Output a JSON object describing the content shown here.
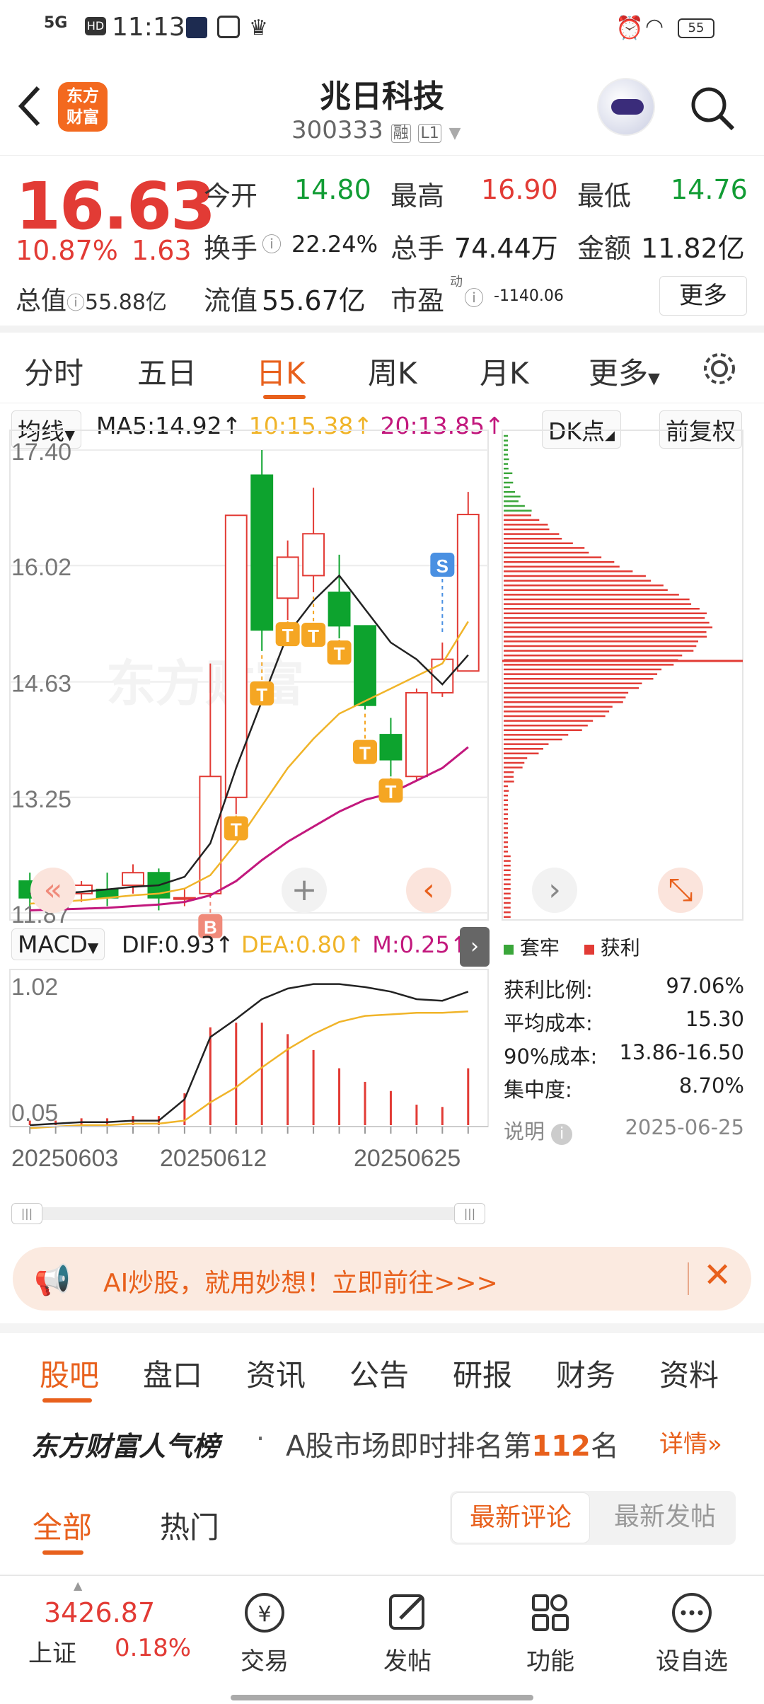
{
  "status": {
    "network": "5G",
    "hd": "HD",
    "time": "11:13",
    "battery": "55"
  },
  "nav": {
    "title": "兆日科技",
    "code": "300333",
    "tag_rong": "融",
    "tag_level": "L1",
    "logo_line1": "东方",
    "logo_line2": "财富"
  },
  "quote": {
    "price": "16.63",
    "change_pct": "10.87%",
    "change_amt": "1.63",
    "open_label": "今开",
    "open": "14.80",
    "high_label": "最高",
    "high": "16.90",
    "low_label": "最低",
    "low": "14.76",
    "turnover_label": "换手",
    "turnover": "22.24%",
    "volume_label": "总手",
    "volume": "74.44万",
    "amount_label": "金额",
    "amount": "11.82亿",
    "mcap_label": "总值",
    "mcap": "55.88亿",
    "float_label": "流值",
    "float": "55.67亿",
    "pe_label": "市盈",
    "pe_sup": "动",
    "pe": "-1140.06",
    "more": "更多"
  },
  "tabs": [
    "分时",
    "五日",
    "日K",
    "周K",
    "月K",
    "更多"
  ],
  "active_tab": 2,
  "kline": {
    "ma_select": "均线",
    "ma5": "MA5:14.92↑",
    "ma10": "10:15.38↑",
    "ma20": "20:13.85↑",
    "dk": "DK点",
    "fq": "前复权",
    "y_labels": [
      "17.40",
      "16.02",
      "14.63",
      "13.25",
      "11.87"
    ],
    "watermark": "东方财富",
    "colors": {
      "up": "#e23b35",
      "down": "#0da32e",
      "ma5": "#222222",
      "ma10": "#f0b429",
      "ma20": "#c2187d"
    }
  },
  "chart_data": {
    "type": "candlestick",
    "ylim": [
      11.87,
      17.4
    ],
    "candles": [
      {
        "o": 12.25,
        "c": 12.05,
        "h": 12.35,
        "l": 11.95
      },
      {
        "o": 12.05,
        "c": 12.15,
        "h": 12.25,
        "l": 11.95
      },
      {
        "o": 12.1,
        "c": 12.2,
        "h": 12.25,
        "l": 12.0
      },
      {
        "o": 12.15,
        "c": 12.05,
        "h": 12.35,
        "l": 11.95
      },
      {
        "o": 12.2,
        "c": 12.35,
        "h": 12.45,
        "l": 12.1
      },
      {
        "o": 12.35,
        "c": 12.05,
        "h": 12.4,
        "l": 11.9
      },
      {
        "o": 12.05,
        "c": 12.05,
        "h": 12.15,
        "l": 11.95
      },
      {
        "o": 12.1,
        "c": 13.5,
        "h": 14.85,
        "l": 12.05
      },
      {
        "o": 13.25,
        "c": 16.62,
        "h": 16.62,
        "l": 13.05
      },
      {
        "o": 17.1,
        "c": 15.25,
        "h": 17.4,
        "l": 15.0
      },
      {
        "o": 15.63,
        "c": 16.12,
        "h": 16.32,
        "l": 15.37
      },
      {
        "o": 15.9,
        "c": 16.4,
        "h": 16.95,
        "l": 15.7
      },
      {
        "o": 15.7,
        "c": 15.3,
        "h": 16.15,
        "l": 15.15
      },
      {
        "o": 15.3,
        "c": 14.35,
        "h": 15.3,
        "l": 14.3
      },
      {
        "o": 14.0,
        "c": 13.7,
        "h": 14.2,
        "l": 13.5
      },
      {
        "o": 13.5,
        "c": 14.5,
        "h": 14.55,
        "l": 13.45
      },
      {
        "o": 14.5,
        "c": 14.9,
        "h": 15.1,
        "l": 14.45
      },
      {
        "o": 14.76,
        "c": 16.63,
        "h": 16.9,
        "l": 14.76
      }
    ],
    "ma5": [
      12.1,
      12.1,
      12.12,
      12.15,
      12.18,
      12.2,
      12.3,
      12.7,
      13.6,
      14.4,
      15.2,
      15.6,
      15.9,
      15.5,
      15.1,
      14.9,
      14.6,
      14.95
    ],
    "ma10": [
      11.98,
      12.0,
      12.02,
      12.05,
      12.08,
      12.1,
      12.16,
      12.32,
      12.7,
      13.15,
      13.6,
      13.95,
      14.25,
      14.4,
      14.55,
      14.7,
      14.85,
      15.35
    ],
    "ma20": [
      11.9,
      11.91,
      11.92,
      11.93,
      11.95,
      11.97,
      12.0,
      12.08,
      12.25,
      12.5,
      12.72,
      12.9,
      13.08,
      13.22,
      13.3,
      13.45,
      13.6,
      13.85
    ],
    "signals": [
      {
        "i": 7,
        "t": "B"
      },
      {
        "i": 8,
        "t": "T"
      },
      {
        "i": 9,
        "t": "T"
      },
      {
        "i": 10,
        "t": "T"
      },
      {
        "i": 11,
        "t": "T"
      },
      {
        "i": 12,
        "t": "T"
      },
      {
        "i": 13,
        "t": "T"
      },
      {
        "i": 14,
        "t": "T"
      },
      {
        "i": 16,
        "t": "S"
      }
    ],
    "macd": {
      "dif": [
        0.05,
        0.06,
        0.07,
        0.07,
        0.08,
        0.08,
        0.22,
        0.63,
        0.75,
        0.88,
        0.95,
        0.98,
        0.98,
        0.96,
        0.93,
        0.88,
        0.87,
        0.93
      ],
      "dea": [
        0.03,
        0.04,
        0.05,
        0.05,
        0.06,
        0.06,
        0.08,
        0.2,
        0.3,
        0.43,
        0.55,
        0.65,
        0.73,
        0.77,
        0.78,
        0.79,
        0.79,
        0.8
      ],
      "m": [
        0.02,
        0.02,
        0.03,
        0.03,
        0.04,
        0.04,
        0.14,
        0.43,
        0.45,
        0.45,
        0.4,
        0.33,
        0.25,
        0.19,
        0.15,
        0.09,
        0.08,
        0.25
      ],
      "ylim": [
        0.05,
        1.02
      ]
    },
    "x_labels": [
      "20250603",
      "20250612",
      "20250625"
    ]
  },
  "macd_bar": {
    "select": "MACD",
    "dif": "DIF:0.93↑",
    "dea": "DEA:0.80↑",
    "m": "M:0.25↑",
    "top": "1.02",
    "bottom": "0.05"
  },
  "chip": {
    "legend_lock": "套牢",
    "legend_profit": "获利",
    "rows": [
      {
        "k": "获利比例:",
        "v": "97.06%"
      },
      {
        "k": "平均成本:",
        "v": "15.30"
      },
      {
        "k": "90%成本:",
        "v": "13.86-16.50"
      },
      {
        "k": "集中度:",
        "v": "8.70%"
      }
    ],
    "note": "说明",
    "date": "2025-06-25"
  },
  "banner": {
    "text": "AI炒股，就用妙想！立即前往>>>"
  },
  "subtabs": [
    "股吧",
    "盘口",
    "资讯",
    "公告",
    "研报",
    "财务",
    "资料"
  ],
  "rank": {
    "brand": "东方财富人气榜",
    "dot": "·",
    "text_before": "A股市场即时排名第",
    "rank": "112",
    "text_after": "名",
    "detail": "详情"
  },
  "filter": {
    "all": "全部",
    "hot": "热门",
    "latest_comment": "最新评论",
    "latest_post": "最新发帖"
  },
  "bottom": {
    "index_value": "3426.87",
    "index_name": "上证",
    "index_pct": "0.18%",
    "trade": "交易",
    "post": "发帖",
    "func": "功能",
    "watch": "设自选"
  }
}
